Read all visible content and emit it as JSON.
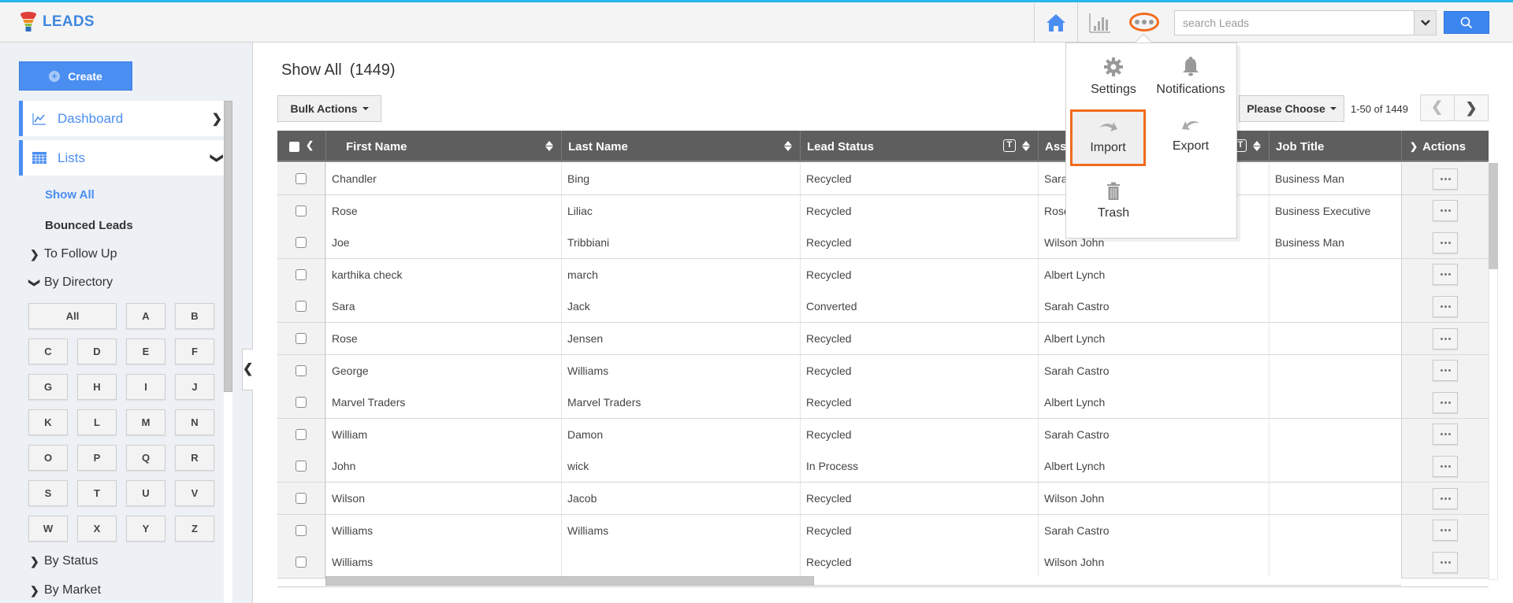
{
  "app": {
    "title": "LEADS"
  },
  "topbar": {
    "search_placeholder": "search Leads",
    "icons": [
      "home-icon",
      "chart-icon",
      "more-icon",
      "chevron-down-icon",
      "search-icon"
    ]
  },
  "more_menu": {
    "items": [
      {
        "label": "Settings",
        "icon": "gear-icon"
      },
      {
        "label": "Notifications",
        "icon": "bell-icon"
      },
      {
        "label": "Import",
        "icon": "import-arrow-icon",
        "highlighted": true
      },
      {
        "label": "Export",
        "icon": "export-arrow-icon"
      },
      {
        "label": "Trash",
        "icon": "trash-icon"
      }
    ]
  },
  "sidebar": {
    "create_label": "Create",
    "nav": [
      {
        "label": "Dashboard",
        "icon": "line-chart-icon"
      },
      {
        "label": "Lists",
        "icon": "calendar-grid-icon"
      }
    ],
    "lists": {
      "show_all": "Show All",
      "bounced": "Bounced Leads",
      "to_follow_up": "To Follow Up",
      "by_directory": "By Directory",
      "by_status": "By Status",
      "by_market": "By Market"
    },
    "letters": [
      "All",
      "A",
      "B",
      "C",
      "D",
      "E",
      "F",
      "G",
      "H",
      "I",
      "J",
      "K",
      "L",
      "M",
      "N",
      "O",
      "P",
      "Q",
      "R",
      "S",
      "T",
      "U",
      "V",
      "W",
      "X",
      "Y",
      "Z"
    ]
  },
  "main": {
    "title": "Show All",
    "count": "(1449)",
    "bulk_actions": "Bulk Actions",
    "please_choose": "Please Choose",
    "page_range": "1-50 of 1449",
    "columns": [
      "First Name",
      "Last Name",
      "Lead Status",
      "Ass",
      "Job Title",
      "Actions"
    ],
    "rows": [
      {
        "first": "Chandler",
        "last": "Bing",
        "status": "Recycled",
        "assigned": "Sara",
        "job": "Business Man"
      },
      {
        "first": "Rose",
        "last": "Liliac",
        "status": "Recycled",
        "assigned": "Rose",
        "job": "Business Executive"
      },
      {
        "first": "Joe",
        "last": "Tribbiani",
        "status": "Recycled",
        "assigned": "Wilson John",
        "job": "Business Man"
      },
      {
        "first": "karthika check",
        "last": "march",
        "status": "Recycled",
        "assigned": "Albert Lynch",
        "job": ""
      },
      {
        "first": "Sara",
        "last": "Jack",
        "status": "Converted",
        "assigned": "Sarah Castro",
        "job": ""
      },
      {
        "first": "Rose",
        "last": "Jensen",
        "status": "Recycled",
        "assigned": "Albert Lynch",
        "job": ""
      },
      {
        "first": "George",
        "last": "Williams",
        "status": "Recycled",
        "assigned": "Sarah Castro",
        "job": ""
      },
      {
        "first": "Marvel Traders",
        "last": "Marvel Traders",
        "status": "Recycled",
        "assigned": "Albert Lynch",
        "job": ""
      },
      {
        "first": "William",
        "last": "Damon",
        "status": "Recycled",
        "assigned": "Sarah Castro",
        "job": ""
      },
      {
        "first": "John",
        "last": "wick",
        "status": "In Process",
        "assigned": "Albert Lynch",
        "job": ""
      },
      {
        "first": "Wilson",
        "last": "Jacob",
        "status": "Recycled",
        "assigned": "Wilson John",
        "job": ""
      },
      {
        "first": "Williams",
        "last": "Williams",
        "status": "Recycled",
        "assigned": "Sarah Castro",
        "job": ""
      },
      {
        "first": "Williams",
        "last": "",
        "status": "Recycled",
        "assigned": "Wilson John",
        "job": ""
      }
    ]
  },
  "colors": {
    "accent": "#4b8ef2",
    "highlight": "#f26b1d",
    "header_bg": "#5e5e5e",
    "top_border": "#29b6e8"
  }
}
